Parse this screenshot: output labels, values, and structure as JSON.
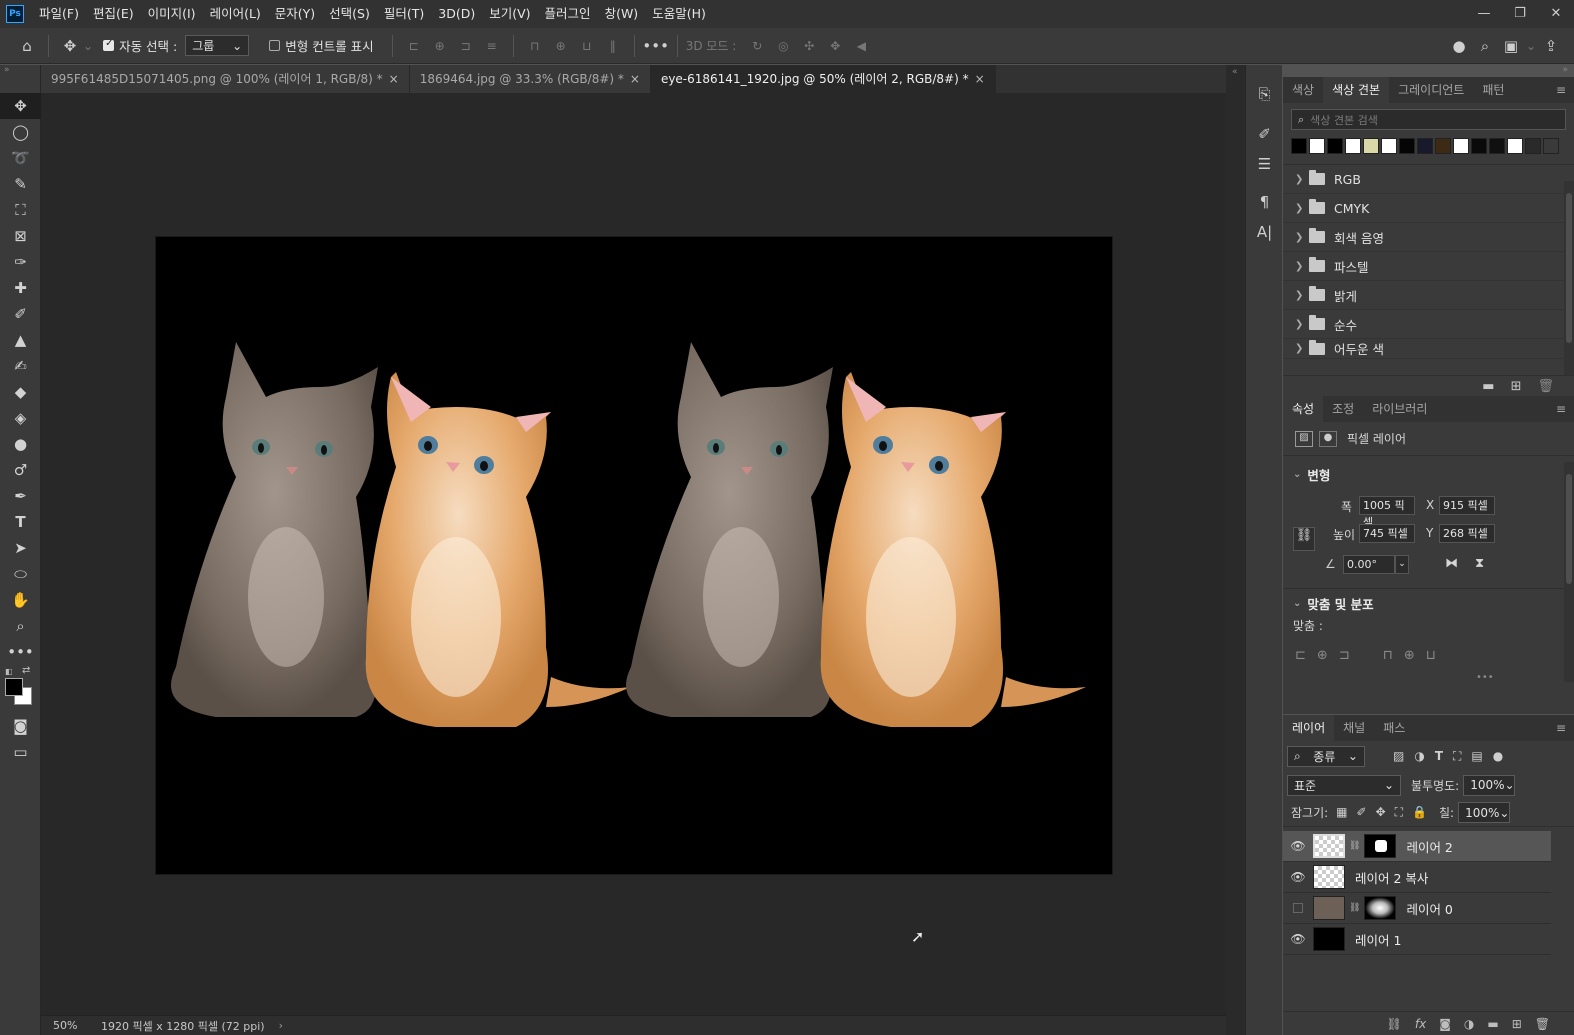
{
  "app": {
    "logo": "Ps",
    "menu": [
      "파일(F)",
      "편집(E)",
      "이미지(I)",
      "레이어(L)",
      "문자(Y)",
      "선택(S)",
      "필터(T)",
      "3D(D)",
      "보기(V)",
      "플러그인",
      "창(W)",
      "도움말(H)"
    ],
    "window_controls": [
      "—",
      "❐",
      "✕"
    ]
  },
  "options_bar": {
    "auto_select_label": "자동 선택 :",
    "auto_select_value": "그룹",
    "transform_controls_label": "변형 컨트롤 표시",
    "mode_3d_label": "3D 모드 :",
    "more": "•••"
  },
  "tabs": [
    {
      "label": "995F61485D15071405.png @ 100% (레이어 1, RGB/8) *",
      "active": false
    },
    {
      "label": "1869464.jpg @ 33.3% (RGB/8#) *",
      "active": false
    },
    {
      "label": "eye-6186141_1920.jpg @ 50% (레이어 2, RGB/8#) *",
      "active": true
    }
  ],
  "status": {
    "zoom": "50%",
    "doc_info": "1920 픽셀 x 1280 픽셀 (72 ppi)",
    "arrow": "›"
  },
  "swatches_panel": {
    "tabs": [
      "색상",
      "색상 견본",
      "그레이디언트",
      "패턴"
    ],
    "active_tab": 1,
    "search_placeholder": "색상 견본 검색",
    "recent_colors": [
      "#000000",
      "#ffffff",
      "#000000",
      "#ffffff",
      "#d9d8a6",
      "#ffffff",
      "#050505",
      "#181a2c",
      "#3c2a14",
      "#ffffff",
      "#0a0a0a",
      "#101010",
      "#ffffff",
      "#2a2a2a",
      "#3a3a3a"
    ],
    "folders": [
      "RGB",
      "CMYK",
      "회색 음영",
      "파스텔",
      "밝게",
      "순수",
      "어두운 색"
    ]
  },
  "properties_panel": {
    "tabs": [
      "속성",
      "조정",
      "라이브러리"
    ],
    "active_tab": 0,
    "layer_type": "픽셀 레이어",
    "transform_title": "변형",
    "width_label": "폭",
    "width_value": "1005 픽셀",
    "height_label": "높이",
    "height_value": "745 픽셀",
    "x_label": "X",
    "x_value": "915 픽셀",
    "y_label": "Y",
    "y_value": "268 픽셀",
    "angle_value": "0.00°",
    "align_title": "맞춤 및 분포",
    "align_label": "맞춤 :",
    "more": "•••"
  },
  "layers_panel": {
    "tabs": [
      "레이어",
      "채널",
      "패스"
    ],
    "active_tab": 0,
    "filter_kind": "종류",
    "blend_mode": "표준",
    "opacity_label": "불투명도:",
    "opacity_value": "100%",
    "lock_label": "잠그기:",
    "fill_label": "칠:",
    "fill_value": "100%",
    "layers": [
      {
        "name": "레이어 2",
        "visible": true,
        "selected": true,
        "mask": true
      },
      {
        "name": "레이어 2 복사",
        "visible": true,
        "selected": false,
        "mask": false
      },
      {
        "name": "레이어 0",
        "visible": false,
        "selected": false,
        "mask": true
      },
      {
        "name": "레이어 1",
        "visible": true,
        "selected": false,
        "mask": false
      }
    ]
  }
}
